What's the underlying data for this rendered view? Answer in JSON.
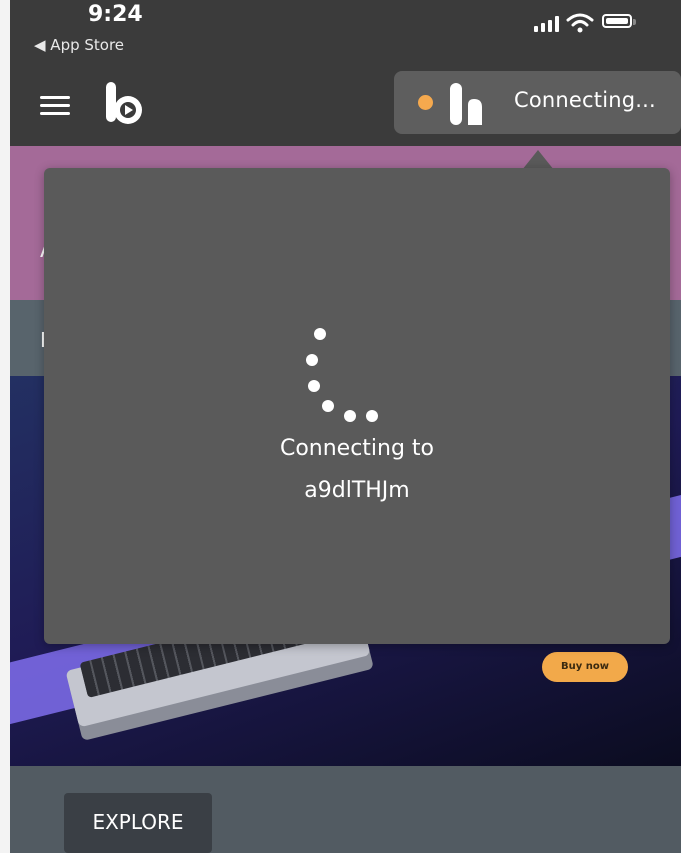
{
  "status_bar": {
    "time": "9:24",
    "back_label": "◀ App Store"
  },
  "header": {
    "connection_status": "Connecting...",
    "status_color": "#f5a94e"
  },
  "page": {
    "banner_letter_1": "A",
    "banner_letter_2": "F",
    "buy_label": "Buy now",
    "explore_label": "EXPLORE"
  },
  "modal": {
    "line1": "Connecting to",
    "line2": "a9dlTHJm"
  },
  "colors": {
    "header_bg": "#3b3b3b",
    "modal_bg": "#5a5a5a",
    "pill_bg": "#5e5e5e",
    "accent": "#f5a94e"
  }
}
